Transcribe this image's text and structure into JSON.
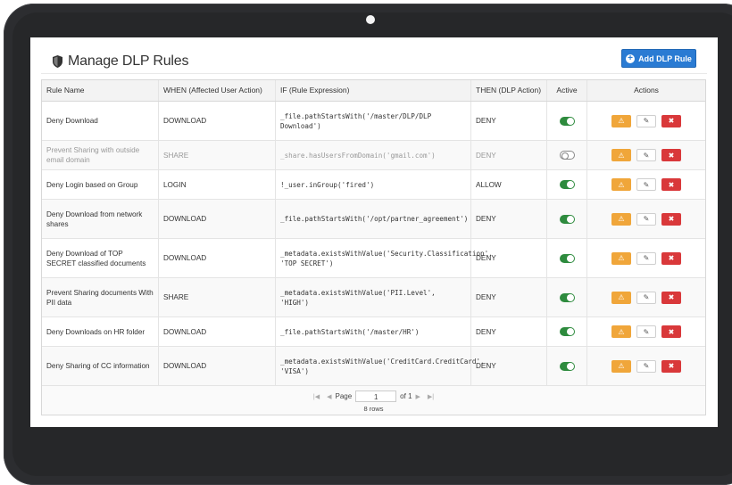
{
  "page_title": "Manage DLP Rules",
  "add_button_label": "Add DLP Rule",
  "columns": [
    "Rule Name",
    "WHEN (Affected User Action)",
    "IF (Rule Expression)",
    "THEN (DLP Action)",
    "Active",
    "Actions"
  ],
  "rows": [
    {
      "name": "Deny Download",
      "when": "DOWNLOAD",
      "if": "_file.pathStartsWith('/master/DLP/DLP Download')",
      "then": "DENY",
      "active": true
    },
    {
      "name": "Prevent Sharing with outside email domain",
      "when": "SHARE",
      "if": "_share.hasUsersFromDomain('gmail.com')",
      "then": "DENY",
      "active": false
    },
    {
      "name": "Deny Login based on Group",
      "when": "LOGIN",
      "if": "!_user.inGroup('fired')",
      "then": "ALLOW",
      "active": true
    },
    {
      "name": "Deny Download from network shares",
      "when": "DOWNLOAD",
      "if": "_file.pathStartsWith('/opt/partner_agreement')",
      "then": "DENY",
      "active": true
    },
    {
      "name": "Deny Download of TOP SECRET classified documents",
      "when": "DOWNLOAD",
      "if": "_metadata.existsWithValue('Security.Classification', 'TOP SECRET')",
      "then": "DENY",
      "active": true
    },
    {
      "name": "Prevent Sharing documents With PII data",
      "when": "SHARE",
      "if": "_metadata.existsWithValue('PII.Level', 'HIGH')",
      "then": "DENY",
      "active": true
    },
    {
      "name": "Deny Downloads on HR folder",
      "when": "DOWNLOAD",
      "if": "_file.pathStartsWith('/master/HR')",
      "then": "DENY",
      "active": true
    },
    {
      "name": "Deny Sharing of CC information",
      "when": "DOWNLOAD",
      "if": "_metadata.existsWithValue('CreditCard.CreditCard', 'VISA')",
      "then": "DENY",
      "active": true
    }
  ],
  "action_icons": {
    "warn": "warning-icon",
    "edit": "edit-icon",
    "delete": "delete-icon"
  },
  "pager": {
    "page_label": "Page",
    "page_value": "1",
    "of_label": "of 1",
    "rows_label": "8 rows"
  },
  "colors": {
    "accent": "#2a7bd3",
    "active_toggle": "#2e8b3e",
    "warn": "#f0a63a",
    "delete": "#d9383a"
  }
}
